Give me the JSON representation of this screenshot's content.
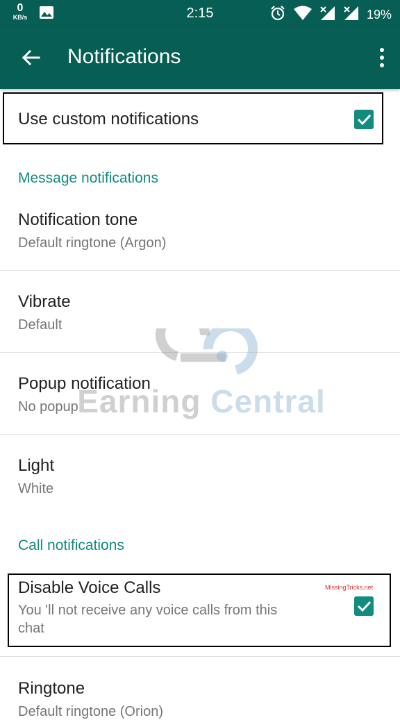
{
  "status_bar": {
    "speed_value": "0",
    "speed_unit": "KB/s",
    "time": "2:15",
    "battery": "19%"
  },
  "app_bar": {
    "title": "Notifications"
  },
  "custom": {
    "label": "Use custom notifications",
    "checked": true
  },
  "message_section": {
    "header": "Message notifications",
    "items": [
      {
        "label": "Notification tone",
        "value": "Default ringtone (Argon)"
      },
      {
        "label": "Vibrate",
        "value": "Default"
      },
      {
        "label": "Popup notification",
        "value": "No popup"
      },
      {
        "label": "Light",
        "value": "White"
      }
    ]
  },
  "call_section": {
    "header": "Call notifications",
    "disable_voice": {
      "label": "Disable Voice Calls",
      "description_line1": "You 'll not receive any voice calls from this",
      "description_line2": "chat",
      "checked": true
    },
    "ringtone": {
      "label": "Ringtone",
      "value": "Default ringtone (Orion)"
    }
  },
  "watermarks": {
    "small": "MissingTricks.net",
    "big_part1": "Earning",
    "big_part2": "Central"
  },
  "colors": {
    "primary_dark": "#075e54",
    "accent": "#128c7e"
  },
  "icons": [
    "image-icon",
    "alarm-icon",
    "wifi-icon",
    "signal-icon",
    "back-arrow-icon",
    "more-vert-icon",
    "checkmark-icon"
  ]
}
